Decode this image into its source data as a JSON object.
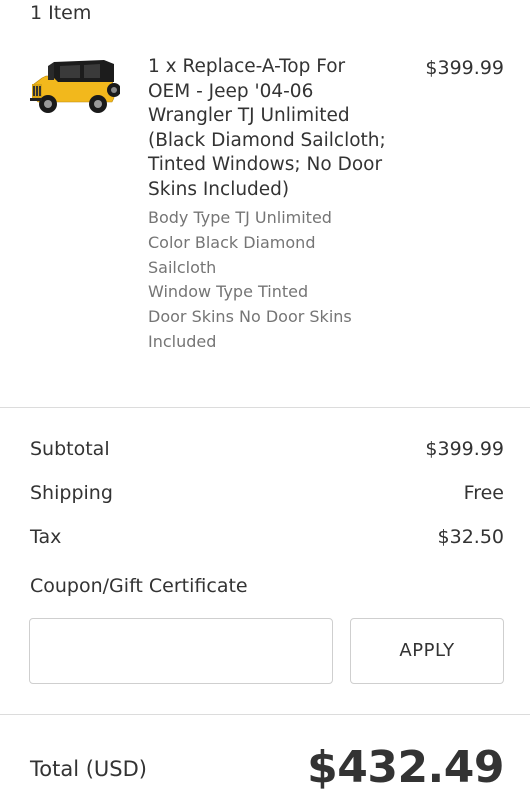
{
  "cart": {
    "items_count": "1 Item"
  },
  "product": {
    "title": "1 x Replace-A-Top For OEM - Jeep '04-06 Wrangler TJ Unlimited (Black Diamond Sailcloth; Tinted Windows; No Door Skins Included)",
    "price": "$399.99",
    "image_name": "jeep-soft-top-thumbnail",
    "options": [
      "Body Type TJ Unlimited",
      "Color Black Diamond Sailcloth",
      "Window Type Tinted",
      "Door Skins No Door Skins Included"
    ]
  },
  "summary": {
    "subtotal_label": "Subtotal",
    "subtotal_value": "$399.99",
    "shipping_label": "Shipping",
    "shipping_value": "Free",
    "tax_label": "Tax",
    "tax_value": "$32.50"
  },
  "coupon": {
    "label": "Coupon/Gift Certificate",
    "input_value": "",
    "apply_label": "APPLY"
  },
  "total": {
    "label": "Total (USD)",
    "value": "$432.49"
  },
  "colors": {
    "text": "#333333",
    "muted": "#757575",
    "border": "#cfcfcf",
    "jeep_body": "#f2b81c",
    "jeep_top": "#1c1c1c"
  }
}
